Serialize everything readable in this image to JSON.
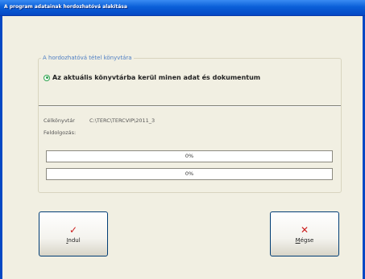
{
  "window": {
    "title": "A program adatainak hordozhatóvá alakítása"
  },
  "group": {
    "title": "A hordozhatóvá tétel könyvtára",
    "radio_label": "Az aktuális könyvtárba kerül minen adat és dokumentum"
  },
  "target": {
    "label": "Célkönyvtár",
    "path": "C:\\TERC\\TERCVIP\\2011_3"
  },
  "processing": {
    "label": "Feldolgozás:"
  },
  "progress": [
    {
      "text": "0%",
      "value": 0
    },
    {
      "text": "0%",
      "value": 0
    }
  ],
  "buttons": {
    "start": {
      "label": "Indul",
      "icon": "checkmark-icon"
    },
    "cancel": {
      "label": "Mégse",
      "icon": "x-icon"
    }
  }
}
